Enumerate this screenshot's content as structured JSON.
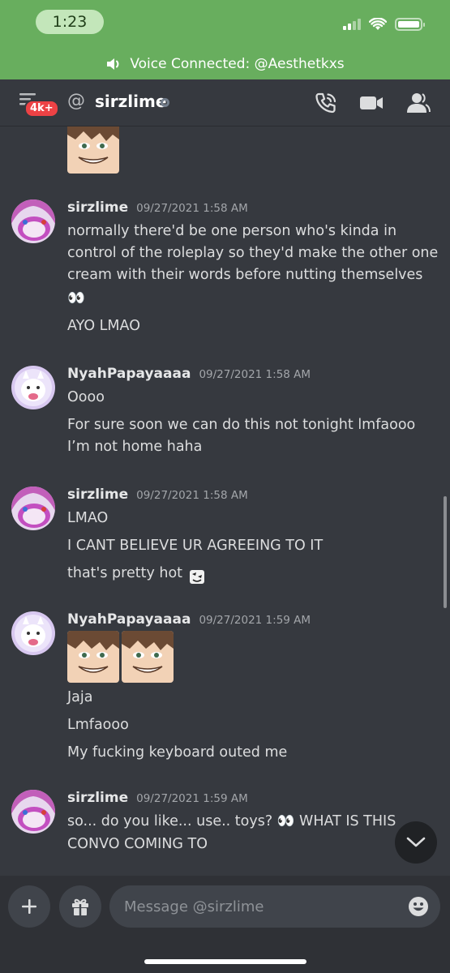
{
  "status_bar": {
    "time": "1:23"
  },
  "voice_banner": {
    "text": "Voice Connected: @Aesthetkxs"
  },
  "header": {
    "badge": "4k+",
    "at": "@",
    "channel": "sirzlime"
  },
  "messages": [
    {
      "author": "sirzlime",
      "timestamp": "09/27/2021 1:58 AM",
      "lines": [
        "normally there'd be one person who's kinda in",
        "control of the roleplay so they'd make the other one",
        "cream with their words before nutting themselves",
        "👀",
        "AYO LMAO"
      ]
    },
    {
      "author": "NyahPapayaaaa",
      "timestamp": "09/27/2021 1:58 AM",
      "lines": [
        "Oooo",
        "For sure soon we can do this not tonight lmfaooo",
        "I’m not home haha"
      ]
    },
    {
      "author": "sirzlime",
      "timestamp": "09/27/2021 1:58 AM",
      "lines": [
        "LMAO",
        "I CANT BELIEVE UR AGREEING TO IT",
        "that's pretty hot"
      ]
    },
    {
      "author": "NyahPapayaaaa",
      "timestamp": "09/27/2021 1:59 AM",
      "lines": [
        "Jaja",
        "Lmfaooo",
        "My fucking keyboard outed me"
      ]
    },
    {
      "author": "sirzlime",
      "timestamp": "09/27/2021 1:59 AM",
      "lines": [
        "so... do you like... use.. toys? 👀 WHAT IS THIS",
        "CONVO COMING TO"
      ]
    }
  ],
  "composer": {
    "placeholder": "Message @sirzlime"
  },
  "icons": {
    "menu": "hamburger-menu-icon",
    "call": "phone-call-icon",
    "video": "video-camera-icon",
    "members": "members-icon",
    "plus": "plus-icon",
    "gift": "gift-icon",
    "emoji": "emoji-icon",
    "jump": "chevron-down-icon"
  },
  "colors": {
    "voice_banner": "#68ae5e",
    "background": "#36393f",
    "composer": "#2f3136",
    "badge": "#ed4245"
  }
}
